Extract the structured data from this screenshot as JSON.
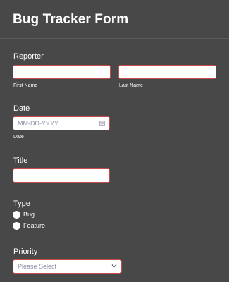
{
  "form": {
    "title": "Bug Tracker Form"
  },
  "reporter": {
    "label": "Reporter",
    "first_name_sublabel": "First Name",
    "last_name_sublabel": "Last Name"
  },
  "date": {
    "label": "Date",
    "placeholder": "MM-DD-YYYY",
    "sublabel": "Date",
    "icon": "calendar-icon"
  },
  "title_field": {
    "label": "Title"
  },
  "type": {
    "label": "Type",
    "options": [
      "Bug",
      "Feature"
    ]
  },
  "priority": {
    "label": "Priority",
    "placeholder": "Please Select",
    "icon": "chevron-down-icon"
  },
  "colors": {
    "background": "#484848",
    "field_border": "#c74b4b",
    "placeholder": "#8a8fa8"
  }
}
